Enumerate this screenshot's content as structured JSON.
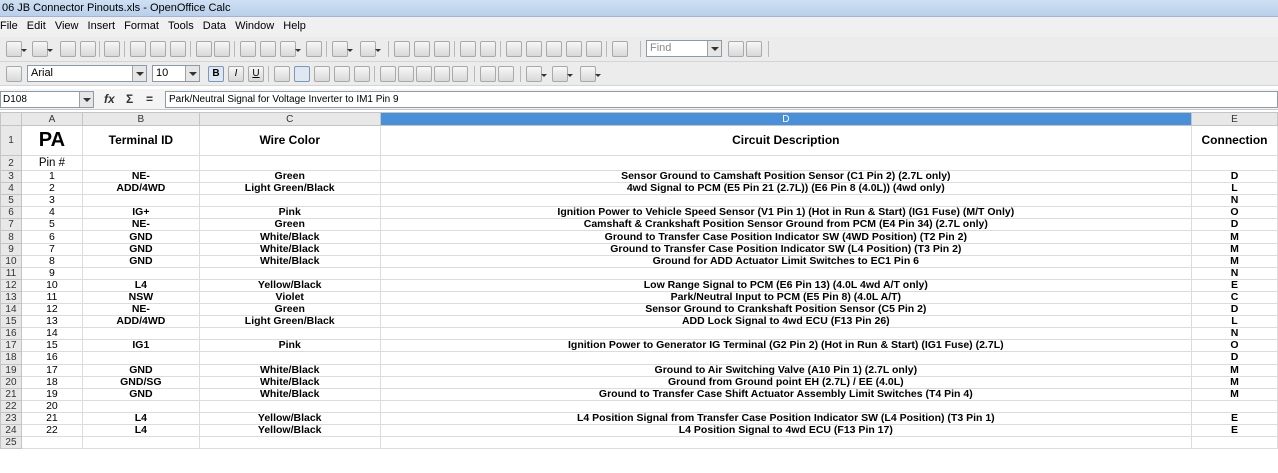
{
  "window": {
    "title": "06 JB Connector Pinouts.xls - OpenOffice Calc"
  },
  "menu": [
    "File",
    "Edit",
    "View",
    "Insert",
    "Format",
    "Tools",
    "Data",
    "Window",
    "Help"
  ],
  "toolbar": {
    "find_placeholder": "Find"
  },
  "format": {
    "font_name": "Arial",
    "font_size": "10",
    "bold": "B",
    "italic": "I",
    "underline": "U"
  },
  "formula": {
    "cell_ref": "D108",
    "content": "Park/Neutral Signal for Voltage Inverter to IM1 Pin 9",
    "fx": "fx",
    "sum": "Σ",
    "equals": "="
  },
  "sheet": {
    "columns": [
      "A",
      "B",
      "C",
      "D",
      "E"
    ],
    "selected_column": "D",
    "rows": [
      {
        "n": "1",
        "a": "PA",
        "b": "Terminal ID",
        "c": "Wire Color",
        "d": "Circuit Description",
        "e": "Connection"
      },
      {
        "n": "2",
        "a": "Pin #",
        "b": "",
        "c": "",
        "d": "",
        "e": ""
      },
      {
        "n": "3",
        "a": "1",
        "b": "NE-",
        "c": "Green",
        "d": "Sensor Ground to Camshaft Position Sensor (C1 Pin 2) (2.7L only)",
        "e": "D"
      },
      {
        "n": "4",
        "a": "2",
        "b": "ADD/4WD",
        "c": "Light Green/Black",
        "d": "4wd Signal to PCM (E5 Pin 21 (2.7L))  (E6 Pin 8 (4.0L)) (4wd only)",
        "e": "L"
      },
      {
        "n": "5",
        "a": "3",
        "b": "",
        "c": "",
        "d": "",
        "e": "N"
      },
      {
        "n": "6",
        "a": "4",
        "b": "IG+",
        "c": "Pink",
        "d": "Ignition Power to Vehicle Speed Sensor (V1 Pin 1) (Hot in Run & Start) (IG1 Fuse) (M/T Only)",
        "e": "O"
      },
      {
        "n": "7",
        "a": "5",
        "b": "NE-",
        "c": "Green",
        "d": "Camshaft & Crankshaft Position Sensor Ground from PCM (E4 Pin 34) (2.7L only)",
        "e": "D"
      },
      {
        "n": "8",
        "a": "6",
        "b": "GND",
        "c": "White/Black",
        "d": "Ground to Transfer Case Position Indicator SW (4WD Position) (T2 Pin 2)",
        "e": "M"
      },
      {
        "n": "9",
        "a": "7",
        "b": "GND",
        "c": "White/Black",
        "d": "Ground to Transfer Case Position Indicator SW (L4 Position) (T3 Pin 2)",
        "e": "M"
      },
      {
        "n": "10",
        "a": "8",
        "b": "GND",
        "c": "White/Black",
        "d": "Ground for ADD Actuator Limit Switches to EC1 Pin 6",
        "e": "M"
      },
      {
        "n": "11",
        "a": "9",
        "b": "",
        "c": "",
        "d": "",
        "e": "N"
      },
      {
        "n": "12",
        "a": "10",
        "b": "L4",
        "c": "Yellow/Black",
        "d": "Low Range Signal to PCM (E6 Pin 13) (4.0L 4wd A/T only)",
        "e": "E"
      },
      {
        "n": "13",
        "a": "11",
        "b": "NSW",
        "c": "Violet",
        "d": "Park/Neutral Input to PCM (E5 Pin 8) (4.0L A/T)",
        "e": "C"
      },
      {
        "n": "14",
        "a": "12",
        "b": "NE-",
        "c": "Green",
        "d": "Sensor Ground to Crankshaft Position Sensor (C5 Pin 2)",
        "e": "D"
      },
      {
        "n": "15",
        "a": "13",
        "b": "ADD/4WD",
        "c": "Light Green/Black",
        "d": "ADD Lock Signal to 4wd ECU (F13 Pin 26)",
        "e": "L"
      },
      {
        "n": "16",
        "a": "14",
        "b": "",
        "c": "",
        "d": "",
        "e": "N"
      },
      {
        "n": "17",
        "a": "15",
        "b": "IG1",
        "c": "Pink",
        "d": "Ignition Power to Generator IG Terminal (G2 Pin 2) (Hot in Run & Start) (IG1 Fuse) (2.7L)",
        "e": "O"
      },
      {
        "n": "18",
        "a": "16",
        "b": "",
        "c": "",
        "d": "",
        "e": "D"
      },
      {
        "n": "19",
        "a": "17",
        "b": "GND",
        "c": "White/Black",
        "d": "Ground to Air Switching Valve (A10 Pin 1) (2.7L only)",
        "e": "M"
      },
      {
        "n": "20",
        "a": "18",
        "b": "GND/SG",
        "c": "White/Black",
        "d": "Ground from Ground point EH (2.7L) / EE (4.0L)",
        "e": "M"
      },
      {
        "n": "21",
        "a": "19",
        "b": "GND",
        "c": "White/Black",
        "d": "Ground to Transfer Case Shift Actuator Assembly Limit Switches (T4 Pin 4)",
        "e": "M"
      },
      {
        "n": "22",
        "a": "20",
        "b": "",
        "c": "",
        "d": "",
        "e": ""
      },
      {
        "n": "23",
        "a": "21",
        "b": "L4",
        "c": "Yellow/Black",
        "d": "L4 Position Signal from Transfer Case Position Indicator SW (L4 Position) (T3 Pin 1)",
        "e": "E"
      },
      {
        "n": "24",
        "a": "22",
        "b": "L4",
        "c": "Yellow/Black",
        "d": "L4 Position Signal to 4wd ECU (F13 Pin 17)",
        "e": "E"
      },
      {
        "n": "25",
        "a": "",
        "b": "",
        "c": "",
        "d": "",
        "e": ""
      }
    ]
  }
}
